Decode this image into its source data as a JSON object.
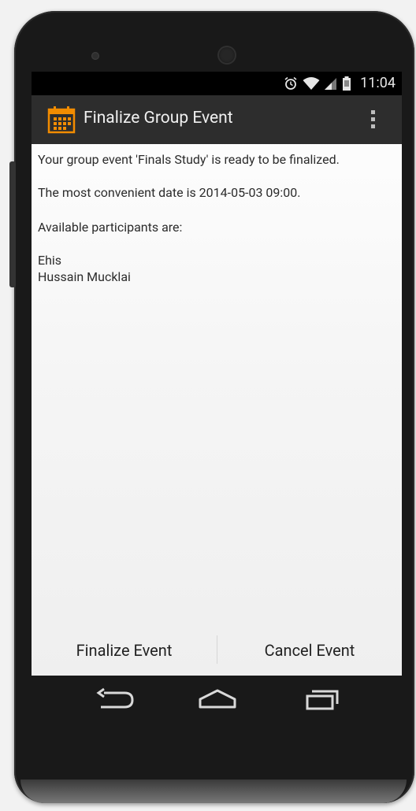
{
  "status_bar": {
    "icons": [
      "alarm-icon",
      "wifi-icon",
      "signal-icon",
      "battery-icon"
    ],
    "time": "11:04"
  },
  "action_bar": {
    "app_icon": "calendar-icon",
    "title": "Finalize Group Event",
    "overflow_icon": "overflow-menu-icon",
    "accent": "#f28c00",
    "background": "#2d2d2d"
  },
  "content": {
    "ready_message": "Your group event 'Finals Study' is ready to be finalized.",
    "date_message": "The most convenient date is 2014-05-03 09:00.",
    "participants_heading": "Available participants are:",
    "participants": [
      "Ehis",
      "Hussain Mucklai"
    ]
  },
  "buttons": {
    "finalize": "Finalize Event",
    "cancel": "Cancel Event"
  },
  "nav_bar": {
    "back_icon": "back-icon",
    "home_icon": "home-icon",
    "recents_icon": "recent-apps-icon"
  }
}
